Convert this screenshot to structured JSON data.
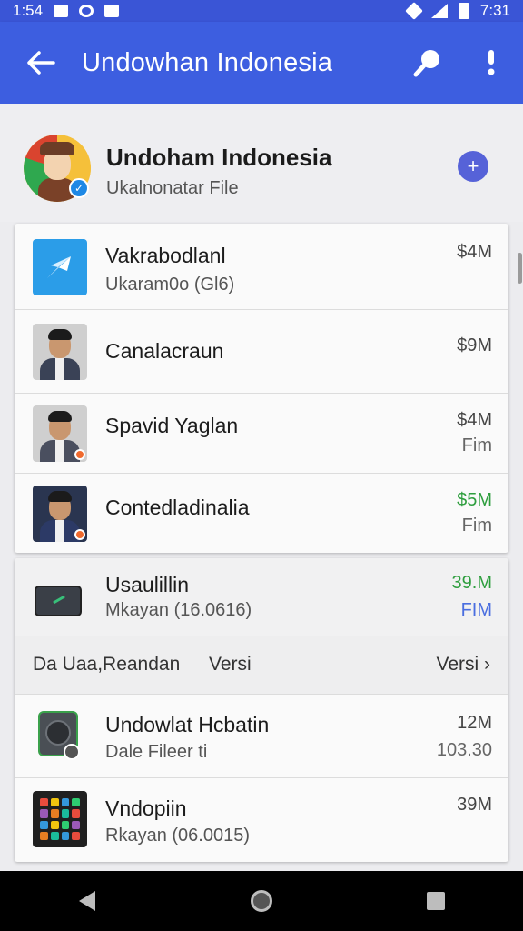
{
  "status_bar": {
    "time": "1:54",
    "clock": "7:31"
  },
  "app_bar": {
    "title": "Undowhan Indonesia"
  },
  "header": {
    "title": "Undoham Indonesia",
    "subtitle": "Ukalnonatar File"
  },
  "card1": {
    "rows": [
      {
        "name": "Vakrabodlanl",
        "sub": "Ukaram0o (Gl6)",
        "size": "$4M",
        "meta": ""
      },
      {
        "name": "Canalacraun",
        "sub": "",
        "size": "$9M",
        "meta": ""
      },
      {
        "name": "Spavid Yaglan",
        "sub": "",
        "size": "$4M",
        "meta": "Fim"
      },
      {
        "name": "Contedladinalia",
        "sub": "",
        "size": "$5M",
        "meta": "Fim"
      }
    ]
  },
  "card2": {
    "top_row": {
      "name": "Usaulillin",
      "sub": "Mkayan (16.0616)",
      "size": "39.M",
      "meta": "FIM"
    },
    "section": {
      "left": "Da Uaa,Reandan",
      "mid": "Versi",
      "right": "Versi ›"
    },
    "rows": [
      {
        "name": "Undowlat Hcbatin",
        "sub": "Dale Fileer ti",
        "size": "12M",
        "meta": "103.30"
      },
      {
        "name": "Vndopiin",
        "sub": "Rkayan (06.0015)",
        "size": "39M",
        "meta": ""
      }
    ]
  },
  "colors": {
    "primary": "#3d5ee0",
    "green_size": "#2e9e3e",
    "blue_meta": "#4a6ee0"
  }
}
